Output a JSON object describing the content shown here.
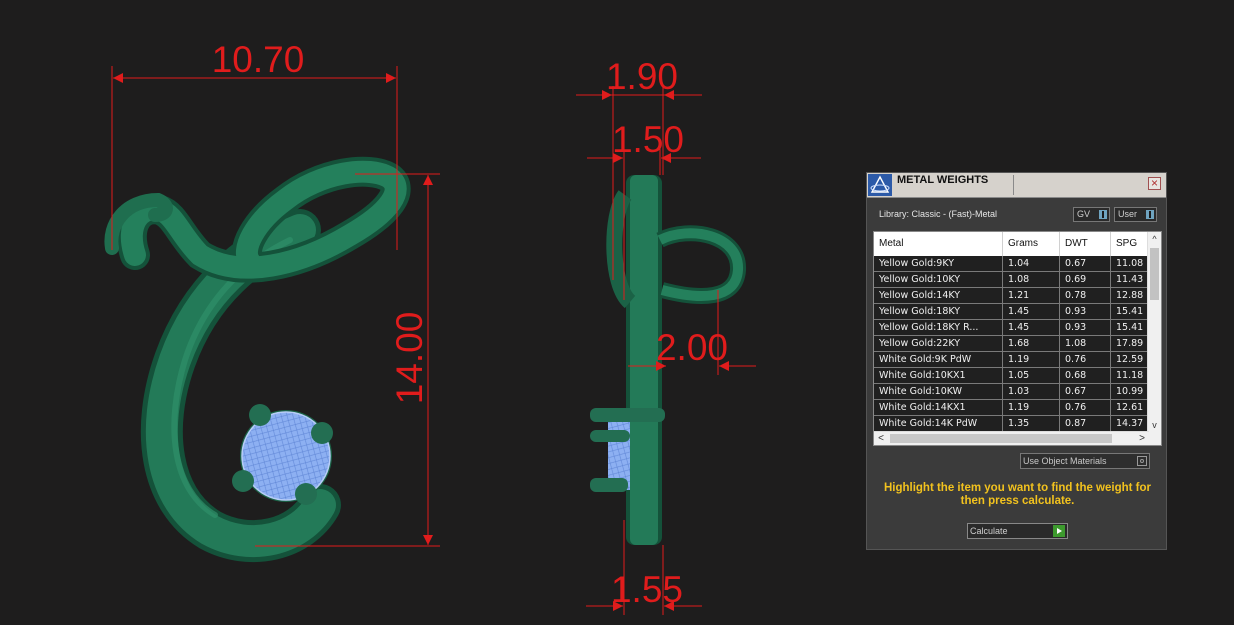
{
  "dimensions": {
    "front_width": "10.70",
    "front_height": "14.00",
    "side_top_outer": "1.90",
    "side_top_inner": "1.50",
    "side_middle": "2.00",
    "side_bottom": "1.55"
  },
  "colors": {
    "background": "#1e1d1d",
    "dimension_lines": "#e01c1c",
    "metal": "#1f6e4f",
    "gemstone": "#7ea6f0",
    "hint_text": "#f2c21e"
  },
  "panel": {
    "title": "METAL WEIGHTS",
    "close_icon": "close-icon",
    "library_label": "Library: Classic - (Fast)-Metal",
    "gv_label": "GV",
    "user_label": "User",
    "table": {
      "headers": [
        "Metal",
        "Grams",
        "DWT",
        "SPG"
      ],
      "rows": [
        [
          "Yellow Gold:9KY",
          "1.04",
          "0.67",
          "11.08"
        ],
        [
          "Yellow Gold:10KY",
          "1.08",
          "0.69",
          "11.43"
        ],
        [
          "Yellow Gold:14KY",
          "1.21",
          "0.78",
          "12.88"
        ],
        [
          "Yellow Gold:18KY",
          "1.45",
          "0.93",
          "15.41"
        ],
        [
          "Yellow Gold:18KY R...",
          "1.45",
          "0.93",
          "15.41"
        ],
        [
          "Yellow Gold:22KY",
          "1.68",
          "1.08",
          "17.89"
        ],
        [
          "White Gold:9K PdW",
          "1.19",
          "0.76",
          "12.59"
        ],
        [
          "White Gold:10KX1",
          "1.05",
          "0.68",
          "11.18"
        ],
        [
          "White Gold:10KW",
          "1.03",
          "0.67",
          "10.99"
        ],
        [
          "White Gold:14KX1",
          "1.19",
          "0.76",
          "12.61"
        ],
        [
          "White Gold:14K PdW",
          "1.35",
          "0.87",
          "14.37"
        ]
      ]
    },
    "use_object_materials": "Use Object Materials",
    "hint": "Highlight the item you want to find the weight for then press calculate.",
    "calculate_label": "Calculate"
  }
}
